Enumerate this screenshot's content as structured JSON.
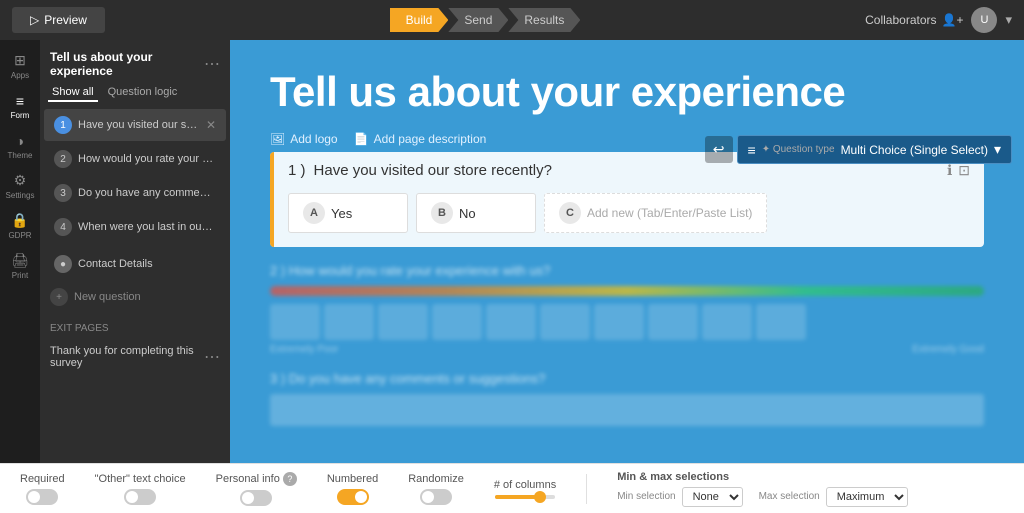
{
  "topbar": {
    "preview_label": "Preview",
    "build_label": "Build",
    "send_label": "Send",
    "results_label": "Results",
    "collaborators_label": "Collaborators",
    "avatar_initials": "U"
  },
  "left_icons": [
    {
      "id": "apps",
      "symbol": "⊞",
      "label": "Apps"
    },
    {
      "id": "form",
      "symbol": "📋",
      "label": "Form"
    },
    {
      "id": "theme",
      "symbol": "🎨",
      "label": "Theme"
    },
    {
      "id": "settings",
      "symbol": "⚙",
      "label": "Settings"
    },
    {
      "id": "gdpr",
      "symbol": "🔒",
      "label": "GDPR"
    },
    {
      "id": "print",
      "symbol": "🖨",
      "label": "Print"
    }
  ],
  "form_panel": {
    "title": "Tell us about your experience",
    "tabs": [
      {
        "id": "show-all",
        "label": "Show all"
      },
      {
        "id": "question-logic",
        "label": "Question logic"
      }
    ],
    "questions": [
      {
        "num": "1",
        "text": "Have you visited our store rece...",
        "active": true
      },
      {
        "num": "2",
        "text": "How would you rate your experience with us?"
      },
      {
        "num": "3",
        "text": "Do you have any comments or suggestions?"
      },
      {
        "num": "4",
        "text": "When were you last in our store?"
      }
    ],
    "contact_section": "Contact Details",
    "new_question": "New question",
    "exit_pages_label": "EXIT PAGES",
    "exit_item": "Thank you for completing this survey"
  },
  "main": {
    "survey_title": "Tell us about your experience",
    "add_logo": "Add logo",
    "add_description": "Add page description",
    "question_type_label": "Question type",
    "question_type_value": "Multi Choice (Single Select)",
    "question_1": {
      "number": "1 )",
      "text": "Have you visited our store recently?",
      "answers": [
        {
          "letter": "A",
          "text": "Yes"
        },
        {
          "letter": "B",
          "text": "No"
        },
        {
          "letter": "C",
          "text": "Add new (Tab/Enter/Paste List)",
          "placeholder": true
        }
      ]
    },
    "question_2_label": "2 )  How would you rate your experience with us?",
    "question_3_label": "3 )  Do you have any comments or suggestions?"
  },
  "bottom_toolbar": {
    "required_label": "Required",
    "other_text_label": "\"Other\" text choice",
    "personal_info_label": "Personal info",
    "numbered_label": "Numbered",
    "randomize_label": "Randomize",
    "columns_label": "# of columns",
    "min_max_label": "Min & max selections",
    "min_selection_label": "Min selection",
    "max_selection_label": "Max selection",
    "min_value": "None",
    "max_value": "Maximum",
    "required_on": false,
    "other_text_on": false,
    "personal_info_on": false,
    "numbered_on": true,
    "randomize_on": false
  }
}
